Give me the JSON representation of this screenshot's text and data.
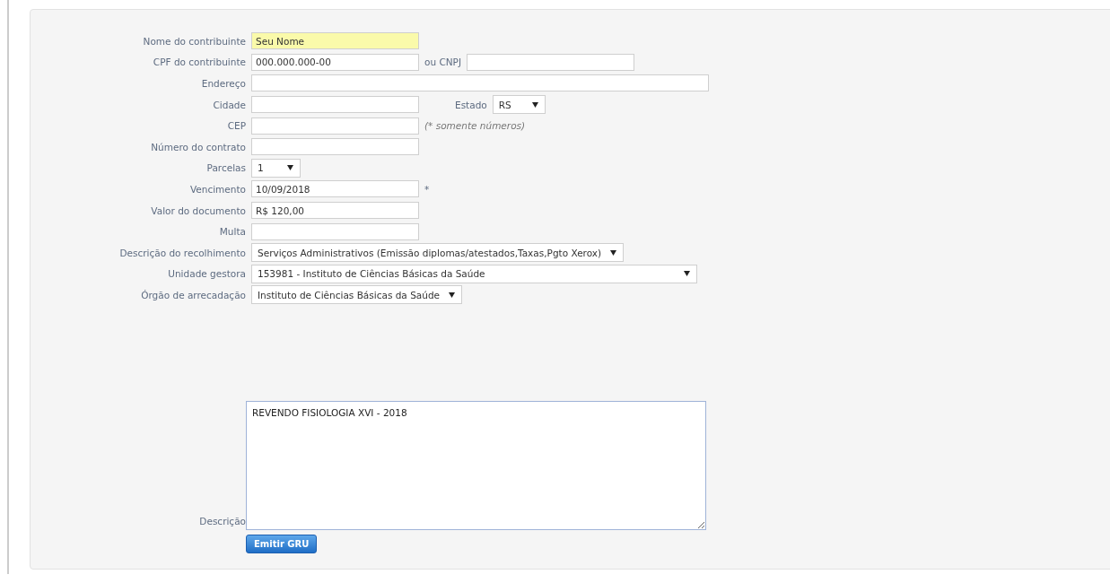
{
  "rows": [
    {
      "label": "Nome do contribuinte",
      "control": {
        "kind": "text",
        "value": "Seu Nome",
        "highlighted": true
      }
    },
    {
      "label": "CPF do contribuinte",
      "control": {
        "kind": "text",
        "value": "000.000.000-00",
        "highlighted": false
      },
      "after": [
        {
          "kind": "field",
          "label": "ou CNPJ"
        }
      ]
    },
    {
      "label": "Endereço",
      "control": {
        "kind": "text",
        "highlighted": false
      }
    },
    {
      "label": "Cidade",
      "control": {
        "kind": "text",
        "highlighted": false
      },
      "after": [
        {
          "kind": "select",
          "label": "Estado",
          "value": "RS"
        }
      ]
    },
    {
      "label": "CEP",
      "control": {
        "kind": "text",
        "highlighted": false
      },
      "after": [
        {
          "kind": "note",
          "text": "(* somente números)"
        }
      ]
    },
    {
      "label": "Número do contrato",
      "control": {
        "kind": "text",
        "highlighted": false
      }
    },
    {
      "label": "Parcelas",
      "control": {
        "kind": "select",
        "value": "1"
      }
    },
    {
      "label": "Vencimento",
      "control": {
        "kind": "text",
        "value": "10/09/2018",
        "highlighted": false
      },
      "after": [
        {
          "kind": "text",
          "text": "*"
        }
      ]
    },
    {
      "label": "Valor do documento",
      "control": {
        "kind": "text",
        "value": "R$ 120,00",
        "highlighted": false
      }
    },
    {
      "label": "Multa",
      "control": {
        "kind": "text",
        "highlighted": false
      }
    },
    {
      "label": "Descrição do recolhimento",
      "control": {
        "kind": "select",
        "value": "Serviços Administrativos (Emissão diplomas/atestados,Taxas,Pgto Xerox)"
      }
    },
    {
      "label": "Unidade gestora",
      "control": {
        "kind": "select",
        "value": "153981 - Instituto de Ciências Básicas da Saúde"
      }
    },
    {
      "label": "Órgão de arrecadação",
      "control": {
        "kind": "select",
        "value": "Instituto de Ciências Básicas da Saúde"
      }
    },
    {
      "label": "Descrição",
      "control": {
        "kind": "textarea",
        "value": "REVENDO FISIOLOGIA XVI - 2018"
      }
    }
  ],
  "button": "Emitir GRU"
}
